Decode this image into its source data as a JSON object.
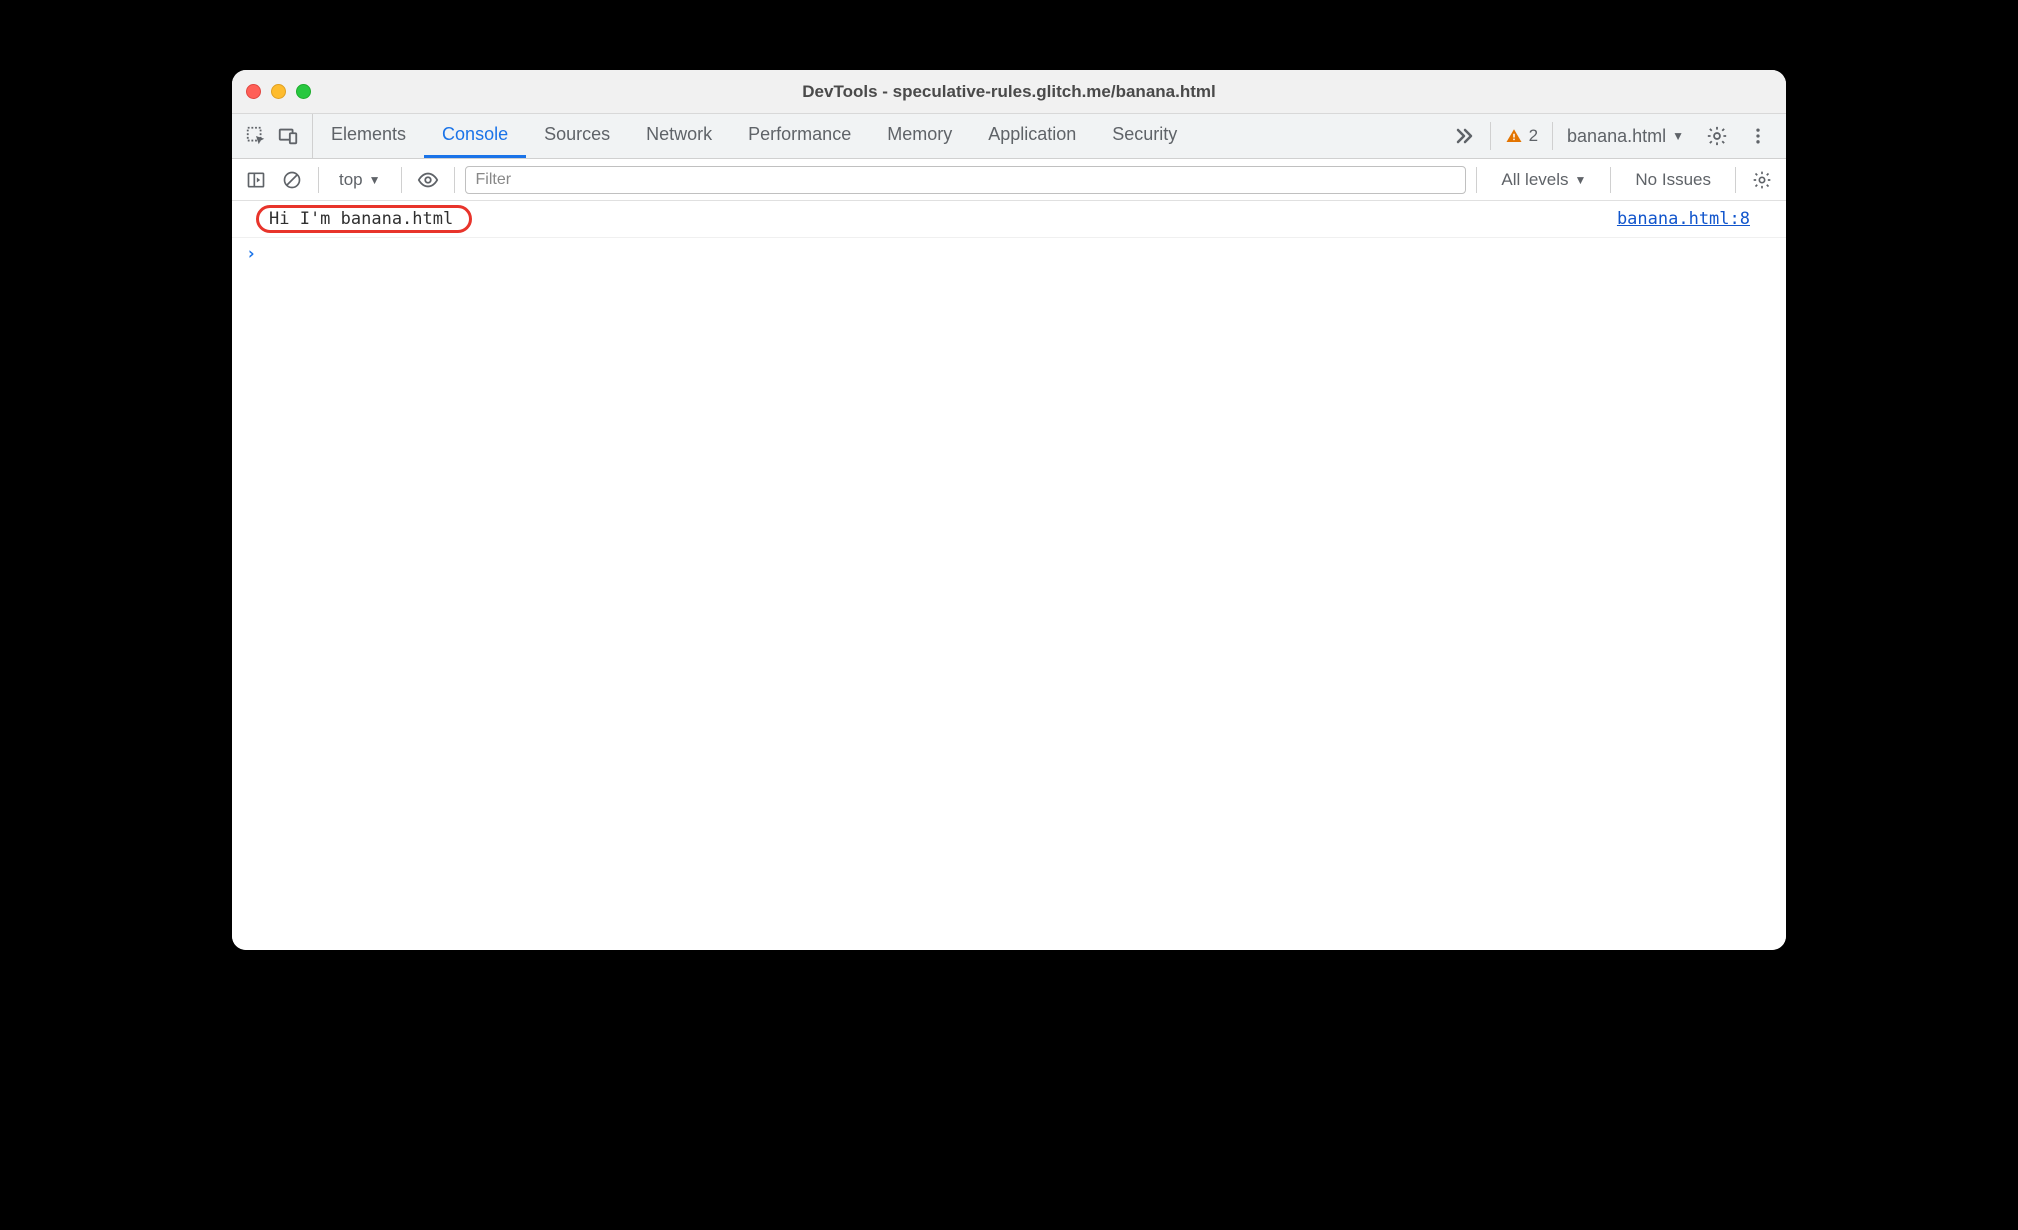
{
  "window": {
    "title": "DevTools - speculative-rules.glitch.me/banana.html"
  },
  "panels": {
    "tabs": [
      "Elements",
      "Console",
      "Sources",
      "Network",
      "Performance",
      "Memory",
      "Application",
      "Security"
    ],
    "active": "Console",
    "warning_count": "2",
    "target_label": "banana.html"
  },
  "console_toolbar": {
    "context_label": "top",
    "filter_placeholder": "Filter",
    "levels_label": "All levels",
    "issues_label": "No Issues"
  },
  "console": {
    "log_message": "Hi I'm banana.html",
    "log_source": "banana.html:8"
  }
}
